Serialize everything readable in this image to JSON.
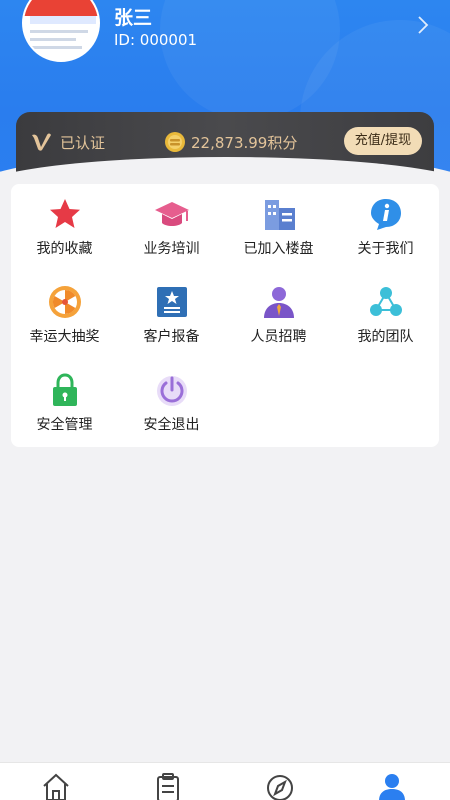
{
  "profile": {
    "name": "张三",
    "id_text": "ID: 000001"
  },
  "vip": {
    "status_label": "已认证",
    "points_text": "22,873.99积分",
    "recharge_label": "充值/提现"
  },
  "menu": [
    {
      "label": "我的收藏",
      "icon": "star-icon",
      "color": "#e63a46"
    },
    {
      "label": "业务培训",
      "icon": "graduation-cap-icon",
      "color": "#e65e8e"
    },
    {
      "label": "已加入楼盘",
      "icon": "building-icon",
      "color": "#6b8fd6"
    },
    {
      "label": "关于我们",
      "icon": "info-icon",
      "color": "#2f8fe8"
    },
    {
      "label": "幸运大抽奖",
      "icon": "lucky-wheel-icon",
      "color": "#f08a2a"
    },
    {
      "label": "客户报备",
      "icon": "report-icon",
      "color": "#2f6fb5"
    },
    {
      "label": "人员招聘",
      "icon": "recruit-person-icon",
      "color": "#7a55c8"
    },
    {
      "label": "我的团队",
      "icon": "team-icon",
      "color": "#3cbfd8"
    },
    {
      "label": "安全管理",
      "icon": "lock-icon",
      "color": "#2fb55a"
    },
    {
      "label": "安全退出",
      "icon": "power-icon",
      "color": "#9a6fd8"
    }
  ],
  "nav": [
    {
      "name": "home-icon"
    },
    {
      "name": "clipboard-icon"
    },
    {
      "name": "compass-icon"
    },
    {
      "name": "user-icon",
      "active": true
    }
  ],
  "colors": {
    "header_blue": "#2b7ff0",
    "gold_text": "#e3c49a",
    "active_blue": "#2b7ff0"
  }
}
